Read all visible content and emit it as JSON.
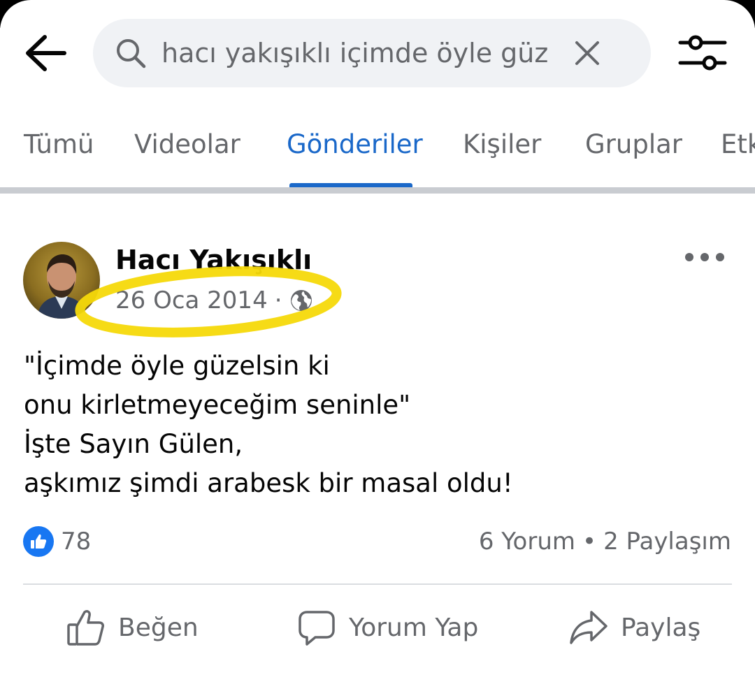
{
  "search": {
    "query": "hacı yakışıklı içimde öyle güz"
  },
  "tabs": [
    {
      "label": "Tümü",
      "active": false
    },
    {
      "label": "Videolar",
      "active": false
    },
    {
      "label": "Gönderiler",
      "active": true
    },
    {
      "label": "Kişiler",
      "active": false
    },
    {
      "label": "Gruplar",
      "active": false
    },
    {
      "label": "Etk",
      "active": false
    }
  ],
  "post": {
    "author": "Hacı Yakışıklı",
    "date": "26 Oca 2014",
    "separator": "·",
    "privacy_icon": "globe-icon",
    "body_lines": [
      "\"İçimde öyle güzelsin ki",
      "onu kirletmeyeceğim seninle\"",
      "İşte Sayın Gülen,",
      "aşkımız şimdi arabesk bir masal oldu!"
    ],
    "likes": "78",
    "comments": "6 Yorum",
    "stats_separator": "•",
    "shares": "2 Paylaşım"
  },
  "actions": {
    "like": "Beğen",
    "comment": "Yorum Yap",
    "share": "Paylaş"
  },
  "colors": {
    "accent": "#1a68c9",
    "like_blue": "#1877f2",
    "secondary_text": "#65676b",
    "search_bg": "#f0f2f5",
    "highlight": "#f5d90a"
  }
}
